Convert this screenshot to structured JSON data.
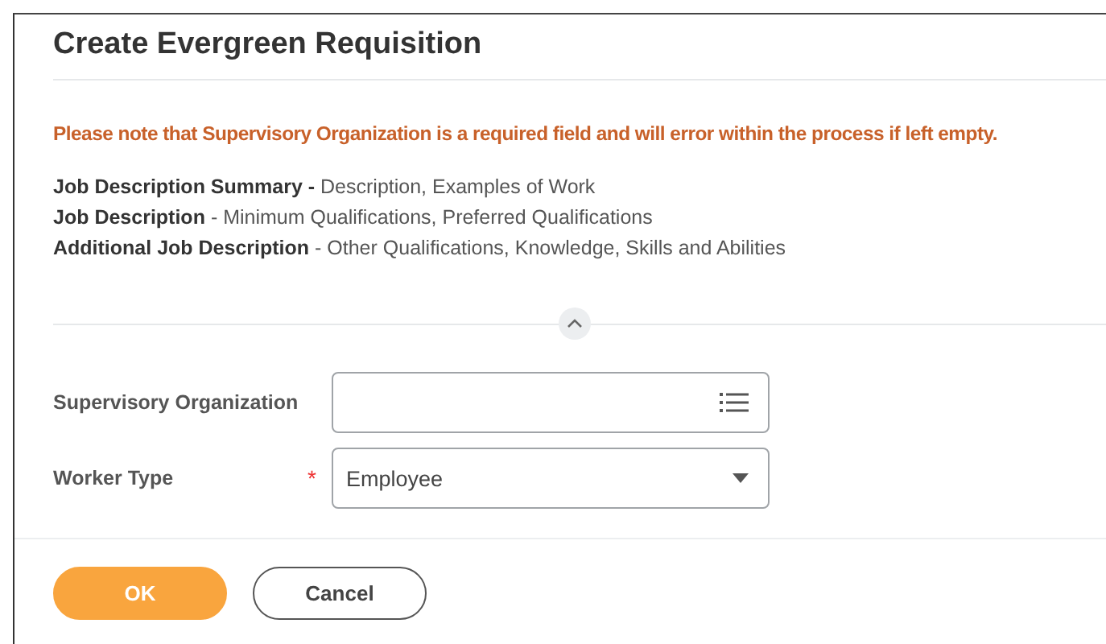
{
  "dialog": {
    "title": "Create Evergreen Requisition",
    "notice": "Please note that Supervisory Organization is a required field and will error within the process if left empty.",
    "descriptions": [
      "**Job Description Summary -** Description, Examples of Work",
      "**Job Description** - Minimum Qualifications, Preferred Qualifications",
      "**Additional Job Description** - Other Qualifications, Knowledge, Skills and Abilities"
    ],
    "required_marker": "*",
    "section_toggle": {
      "expanded": true
    },
    "fields": [
      {
        "label": "Supervisory Organization",
        "kind": "lookup",
        "required": false
      },
      {
        "label": "Worker Type",
        "kind": "select",
        "required": true,
        "value": "Employee"
      }
    ],
    "buttons": [
      {
        "label": "OK",
        "kind": "primary"
      },
      {
        "label": "Cancel",
        "kind": "secondary"
      }
    ]
  }
}
